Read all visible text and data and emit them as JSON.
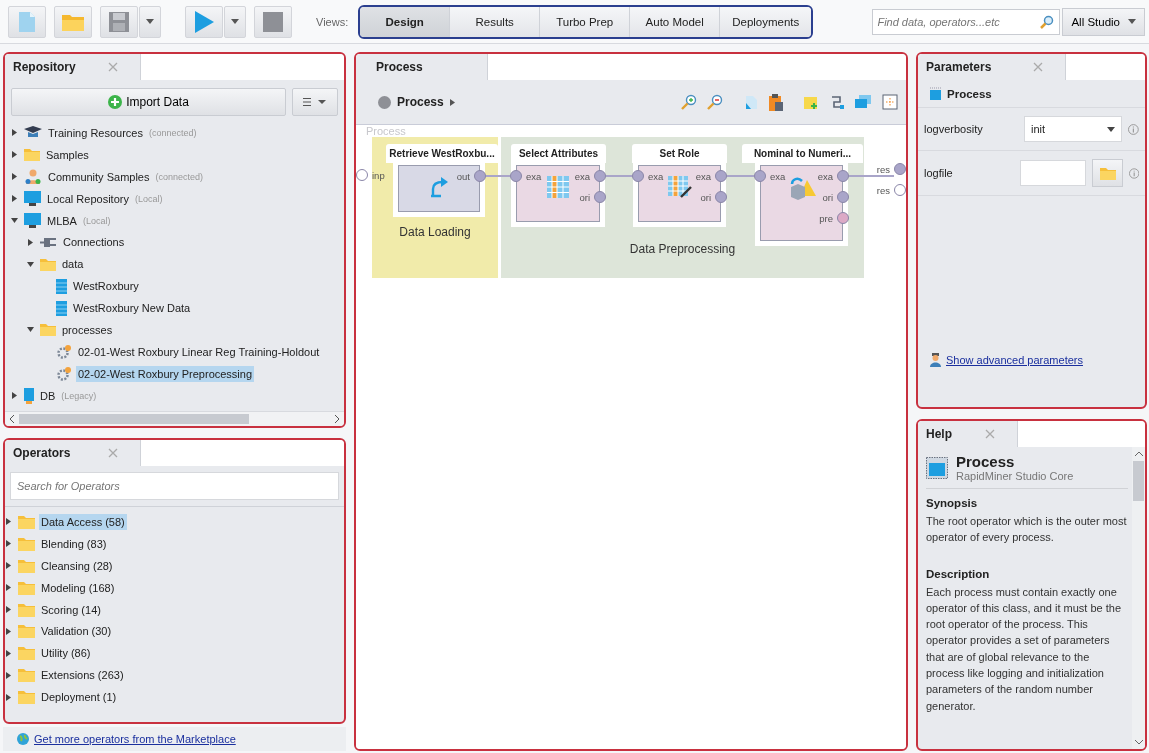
{
  "toolbar": {
    "views_label": "Views:",
    "views": [
      {
        "label": "Design",
        "selected": true
      },
      {
        "label": "Results",
        "selected": false
      },
      {
        "label": "Turbo Prep",
        "selected": false
      },
      {
        "label": "Auto Model",
        "selected": false
      },
      {
        "label": "Deployments",
        "selected": false
      }
    ],
    "search": {
      "placeholder": "Find data, operators...etc"
    },
    "scope": "All Studio"
  },
  "repository": {
    "tab": "Repository",
    "import_button": "Import Data",
    "tree": [
      {
        "label": "Training Resources",
        "note": "(connected)",
        "kind": "training",
        "expanded": false,
        "selected": false
      },
      {
        "label": "Samples",
        "kind": "folder",
        "expanded": false,
        "selected": false
      },
      {
        "label": "Community Samples",
        "note": "(connected)",
        "kind": "community",
        "expanded": false,
        "selected": false
      },
      {
        "label": "Local Repository",
        "note": "(Local)",
        "kind": "repository",
        "expanded": false,
        "selected": false
      },
      {
        "label": "MLBA",
        "note": "(Local)",
        "kind": "repository",
        "expanded": true,
        "selected": false,
        "children": [
          {
            "label": "Connections",
            "kind": "connections",
            "expanded": false,
            "selected": false
          },
          {
            "label": "data",
            "kind": "folder",
            "expanded": true,
            "selected": false,
            "children": [
              {
                "label": "WestRoxbury",
                "kind": "data",
                "selected": false
              },
              {
                "label": "WestRoxbury New Data",
                "kind": "data",
                "selected": false
              }
            ]
          },
          {
            "label": "processes",
            "kind": "folder",
            "expanded": true,
            "selected": false,
            "children": [
              {
                "label": "02-01-West Roxbury Linear Reg Training-Holdout",
                "kind": "process",
                "selected": false
              },
              {
                "label": "02-02-West Roxbury Preprocessing",
                "kind": "process",
                "selected": true
              }
            ]
          }
        ]
      },
      {
        "label": "DB",
        "note": "(Legacy)",
        "kind": "db",
        "expanded": false,
        "selected": false
      }
    ]
  },
  "operators": {
    "tab": "Operators",
    "search": {
      "placeholder": "Search for Operators"
    },
    "groups": [
      {
        "label": "Data Access (58)",
        "selected": true
      },
      {
        "label": "Blending (83)",
        "selected": false
      },
      {
        "label": "Cleansing (28)",
        "selected": false
      },
      {
        "label": "Modeling (168)",
        "selected": false
      },
      {
        "label": "Scoring (14)",
        "selected": false
      },
      {
        "label": "Validation (30)",
        "selected": false
      },
      {
        "label": "Utility (86)",
        "selected": false
      },
      {
        "label": "Extensions (263)",
        "selected": false
      },
      {
        "label": "Deployment (1)",
        "selected": false
      }
    ],
    "marketplace_link": "Get more operators from the Marketplace"
  },
  "process": {
    "tab": "Process",
    "breadcrumb": "Process",
    "canvas": {
      "label": "Process",
      "input_port": "inp",
      "output_ports": [
        {
          "label": "res",
          "color": "#a9a5c9"
        },
        {
          "label": "res",
          "color": "#ffffff"
        }
      ],
      "groups": [
        {
          "label": "Data Loading",
          "color": "#f1ebaa"
        },
        {
          "label": "Data Preprocessing",
          "color": "#dde5d9"
        }
      ],
      "operators": [
        {
          "title": "Retrieve WestRoxbu...",
          "kind": "retrieve",
          "outputs": [
            {
              "label": "out",
              "color": "#a9a5c9"
            }
          ]
        },
        {
          "title": "Select Attributes",
          "kind": "select",
          "inputs": [
            {
              "label": "exa",
              "color": "#a9a5c9"
            }
          ],
          "outputs": [
            {
              "label": "exa",
              "color": "#a9a5c9"
            },
            {
              "label": "ori",
              "color": "#a9a5c9"
            }
          ]
        },
        {
          "title": "Set Role",
          "kind": "role",
          "inputs": [
            {
              "label": "exa",
              "color": "#a9a5c9"
            }
          ],
          "outputs": [
            {
              "label": "exa",
              "color": "#a9a5c9"
            },
            {
              "label": "ori",
              "color": "#a9a5c9"
            }
          ]
        },
        {
          "title": "Nominal to Numeri...",
          "kind": "convert",
          "inputs": [
            {
              "label": "exa",
              "color": "#a9a5c9"
            }
          ],
          "outputs": [
            {
              "label": "exa",
              "color": "#a9a5c9"
            },
            {
              "label": "ori",
              "color": "#a9a5c9"
            },
            {
              "label": "pre",
              "color": "#dcaac6"
            }
          ]
        }
      ]
    }
  },
  "parameters": {
    "tab": "Parameters",
    "operator": "Process",
    "rows": [
      {
        "label": "logverbosity",
        "kind": "select",
        "value": "init"
      },
      {
        "label": "logfile",
        "kind": "file"
      }
    ],
    "advanced_link": "Show advanced parameters"
  },
  "help": {
    "tab": "Help",
    "title": "Process",
    "subtitle": "RapidMiner Studio Core",
    "sections": [
      {
        "heading": "Synopsis",
        "text": "The root operator which is the outer most operator of every process."
      },
      {
        "heading": "Description",
        "text": "Each process must contain exactly one operator of this class, and it must be the root operator of the process. This operator provides a set of parameters that are of global relevance to the process like logging and initialization parameters of the random number generator."
      }
    ]
  }
}
